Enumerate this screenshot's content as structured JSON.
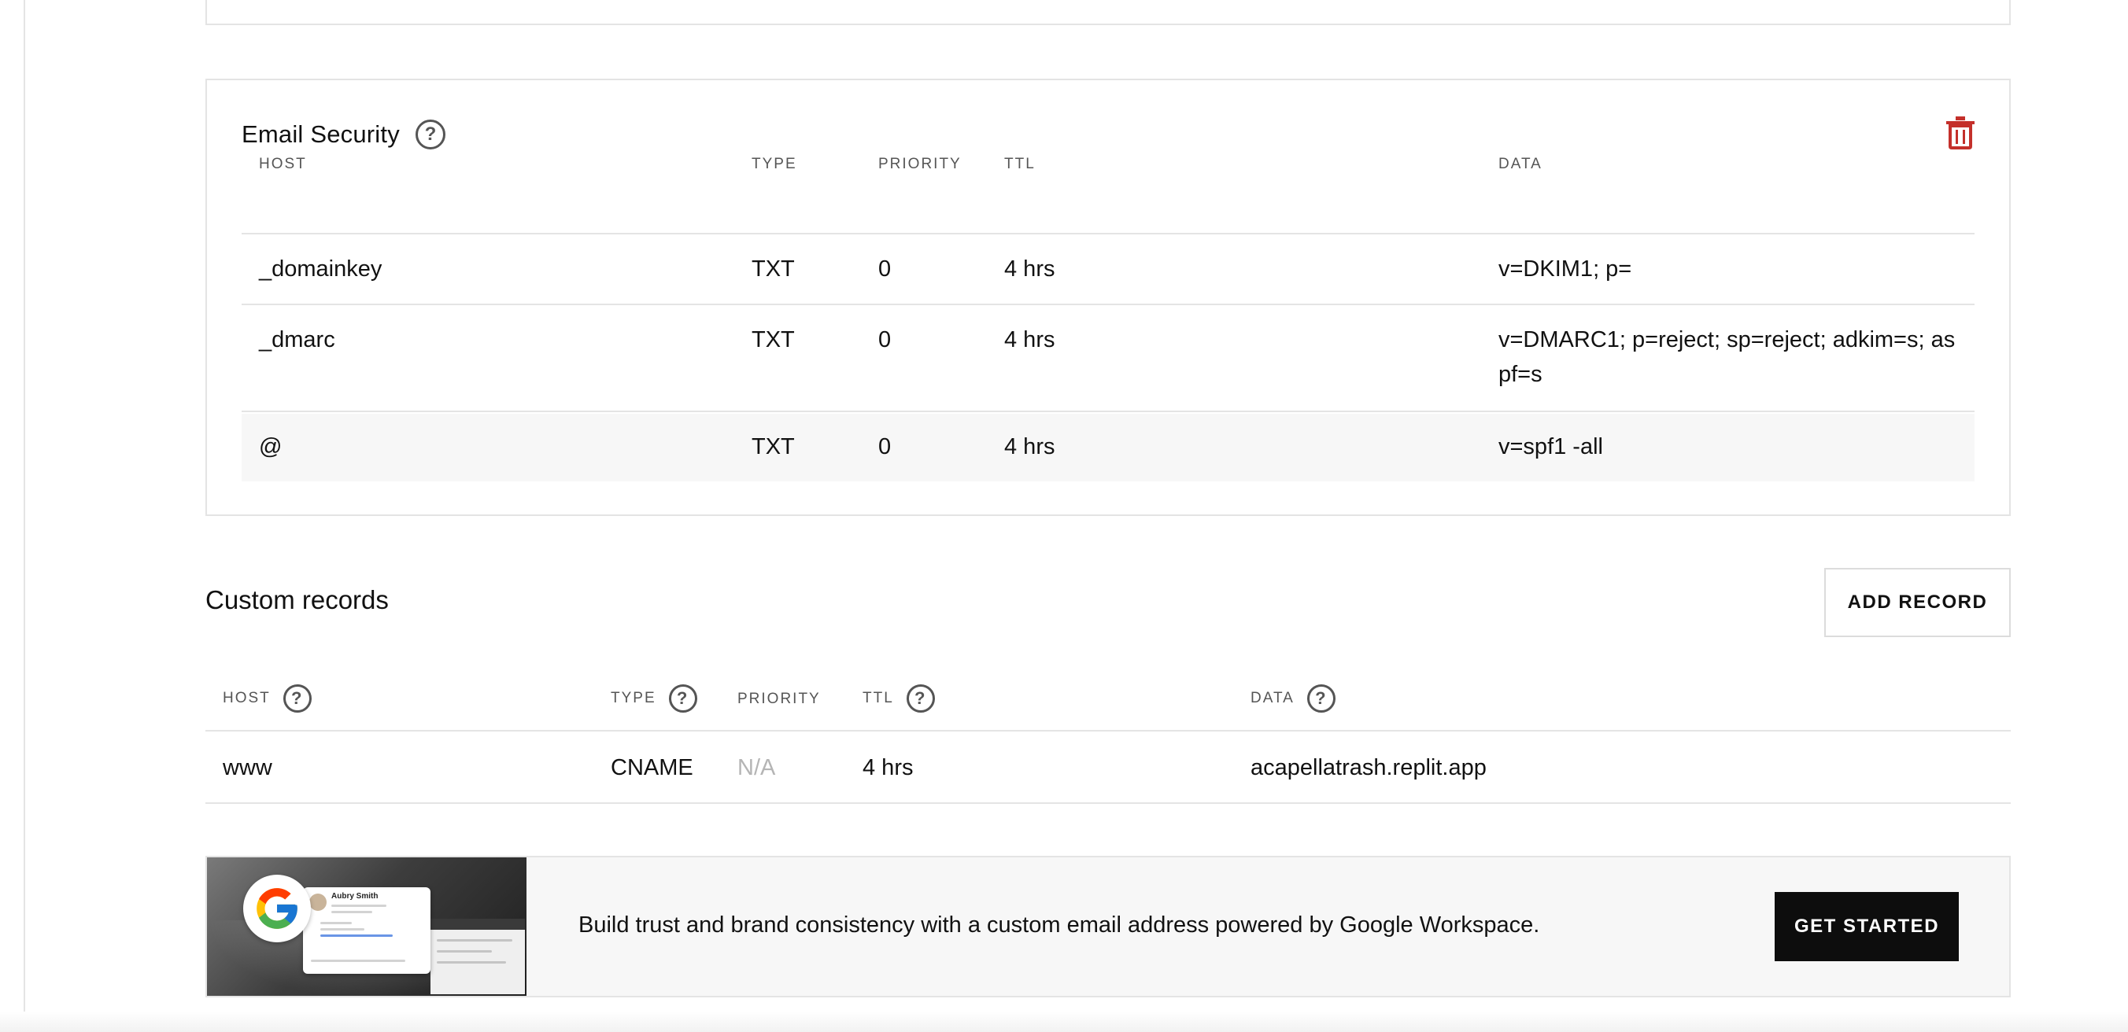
{
  "email_security": {
    "title": "Email Security",
    "columns": [
      "HOST",
      "TYPE",
      "PRIORITY",
      "TTL",
      "DATA"
    ],
    "rows": [
      {
        "host": "_domainkey",
        "type": "TXT",
        "priority": "0",
        "ttl": "4 hrs",
        "data": "v=DKIM1; p="
      },
      {
        "host": "_dmarc",
        "type": "TXT",
        "priority": "0",
        "ttl": "4 hrs",
        "data_line1": "v=DMARC1; p=reject; sp=reject; adkim=s; as",
        "data_line2": "pf=s"
      },
      {
        "host": "@",
        "type": "TXT",
        "priority": "0",
        "ttl": "4 hrs",
        "data": "v=spf1 -all"
      }
    ]
  },
  "custom_records": {
    "title": "Custom records",
    "add_button": "ADD RECORD",
    "columns": [
      "HOST",
      "TYPE",
      "PRIORITY",
      "TTL",
      "DATA"
    ],
    "rows": [
      {
        "host": "www",
        "type": "CNAME",
        "priority": "N/A",
        "ttl": "4 hrs",
        "data": "acapellatrash.replit.app"
      }
    ]
  },
  "promo": {
    "text": "Build trust and brand consistency with a custom email address powered by Google Workspace.",
    "button": "GET STARTED",
    "card_name": "Aubry Smith"
  },
  "icons": {
    "help": "question-circle-icon",
    "delete": "trash-icon",
    "google": "google-g-logo"
  },
  "colors": {
    "delete_red": "#c4302b",
    "button_dark": "#0d0d0d",
    "border": "#e4e4e4",
    "muted_text": "#555555",
    "placeholder_text": "#b5b5b5"
  }
}
